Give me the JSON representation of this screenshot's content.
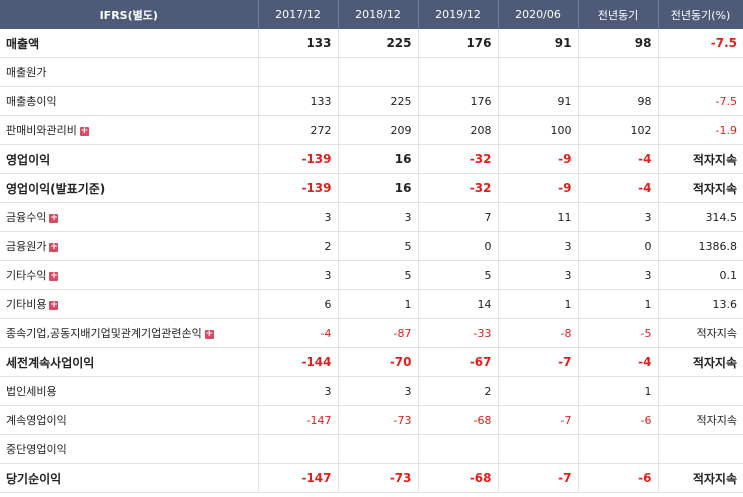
{
  "header": {
    "label": "IFRS(별도)",
    "columns": [
      "2017/12",
      "2018/12",
      "2019/12",
      "2020/06",
      "전년동기",
      "전년동기(%)"
    ]
  },
  "icon": {
    "expand": "plus-icon",
    "symbol": "+"
  },
  "rows": [
    {
      "label": "매출액",
      "bold": true,
      "expand": false,
      "values": [
        "133",
        "225",
        "176",
        "91",
        "98",
        "-7.5"
      ]
    },
    {
      "label": "매출원가",
      "bold": false,
      "expand": false,
      "values": [
        "",
        "",
        "",
        "",
        "",
        ""
      ]
    },
    {
      "label": "매출총이익",
      "bold": false,
      "expand": false,
      "values": [
        "133",
        "225",
        "176",
        "91",
        "98",
        "-7.5"
      ]
    },
    {
      "label": "판매비와관리비",
      "bold": false,
      "expand": true,
      "values": [
        "272",
        "209",
        "208",
        "100",
        "102",
        "-1.9"
      ]
    },
    {
      "label": "영업이익",
      "bold": true,
      "expand": false,
      "values": [
        "-139",
        "16",
        "-32",
        "-9",
        "-4",
        "적자지속"
      ]
    },
    {
      "label": "영업이익(발표기준)",
      "bold": true,
      "expand": false,
      "values": [
        "-139",
        "16",
        "-32",
        "-9",
        "-4",
        "적자지속"
      ]
    },
    {
      "label": "금융수익",
      "bold": false,
      "expand": true,
      "values": [
        "3",
        "3",
        "7",
        "11",
        "3",
        "314.5"
      ]
    },
    {
      "label": "금융원가",
      "bold": false,
      "expand": true,
      "values": [
        "2",
        "5",
        "0",
        "3",
        "0",
        "1386.8"
      ]
    },
    {
      "label": "기타수익",
      "bold": false,
      "expand": true,
      "values": [
        "3",
        "5",
        "5",
        "3",
        "3",
        "0.1"
      ]
    },
    {
      "label": "기타비용",
      "bold": false,
      "expand": true,
      "values": [
        "6",
        "1",
        "14",
        "1",
        "1",
        "13.6"
      ]
    },
    {
      "label": "종속기업,공동지배기업및관계기업관련손익",
      "bold": false,
      "expand": true,
      "values": [
        "-4",
        "-87",
        "-33",
        "-8",
        "-5",
        "적자지속"
      ]
    },
    {
      "label": "세전계속사업이익",
      "bold": true,
      "expand": false,
      "values": [
        "-144",
        "-70",
        "-67",
        "-7",
        "-4",
        "적자지속"
      ]
    },
    {
      "label": "법인세비용",
      "bold": false,
      "expand": false,
      "values": [
        "3",
        "3",
        "2",
        "",
        "1",
        ""
      ]
    },
    {
      "label": "계속영업이익",
      "bold": false,
      "expand": false,
      "values": [
        "-147",
        "-73",
        "-68",
        "-7",
        "-6",
        "적자지속"
      ]
    },
    {
      "label": "중단영업이익",
      "bold": false,
      "expand": false,
      "values": [
        "",
        "",
        "",
        "",
        "",
        ""
      ]
    },
    {
      "label": "당기순이익",
      "bold": true,
      "expand": false,
      "values": [
        "-147",
        "-73",
        "-68",
        "-7",
        "-6",
        "적자지속"
      ]
    }
  ],
  "colors": {
    "header_bg": "#4e5b78",
    "negative": "#e0201b",
    "expand_icon": "#d94a63"
  }
}
